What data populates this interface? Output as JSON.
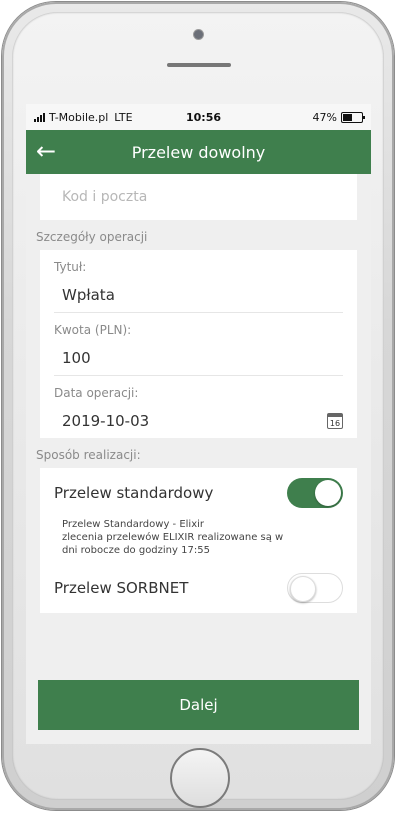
{
  "status": {
    "carrier": "T-Mobile.pl",
    "network": "LTE",
    "time": "10:56",
    "battery": "47%"
  },
  "appbar": {
    "back_icon": "back-arrow-icon",
    "title": "Przelew dowolny"
  },
  "address": {
    "postal_placeholder": "Kod i poczta"
  },
  "details": {
    "section_title": "Szczegóły operacji",
    "title_label": "Tytuł:",
    "title_value": "Wpłata",
    "amount_label": "Kwota (PLN):",
    "amount_value": "100",
    "date_label": "Data operacji:",
    "date_value": "2019-10-03",
    "calendar_icon_text": "16"
  },
  "method": {
    "section_title": "Sposób realizacji:",
    "standard_label": "Przelew standardowy",
    "standard_on": true,
    "standard_desc_line1": "Przelew Standardowy - Elixir",
    "standard_desc_line2": "zlecenia przelewów ELIXIR realizowane są w",
    "standard_desc_line3": "dni robocze do godziny 17:55",
    "sorbnet_label": "Przelew SORBNET",
    "sorbnet_on": false
  },
  "actions": {
    "next_label": "Dalej"
  },
  "colors": {
    "brand_green": "#3f7f4d"
  }
}
